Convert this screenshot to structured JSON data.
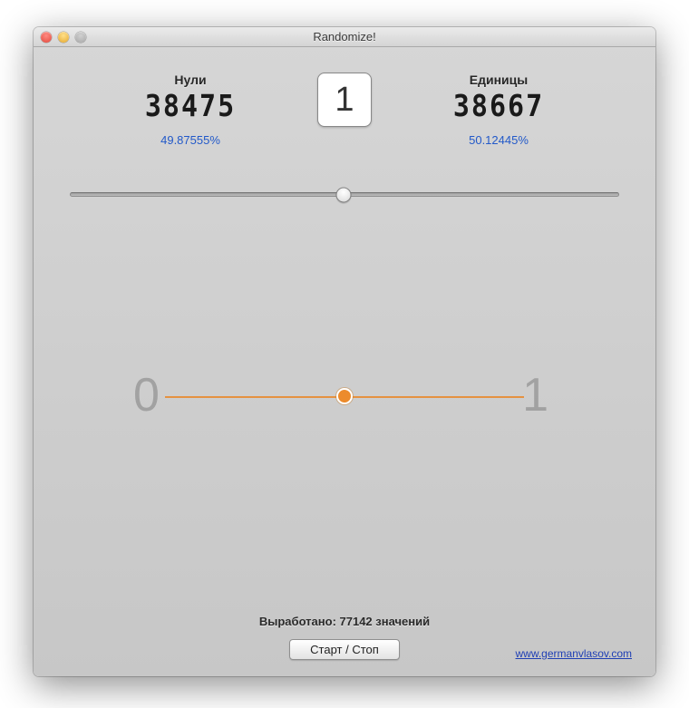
{
  "window": {
    "title": "Randomize!"
  },
  "stats": {
    "zeros": {
      "label": "Нули",
      "count": "38475",
      "percent": "49.87555%"
    },
    "ones": {
      "label": "Единицы",
      "count": "38667",
      "percent": "50.12445%"
    },
    "current": "1"
  },
  "slider": {
    "position_pct": 49.8
  },
  "viz": {
    "left_label": "0",
    "right_label": "1",
    "dot_pct": 50
  },
  "footer": {
    "generated": "Выработано: 77142 значений",
    "button": "Старт / Стоп",
    "link_text": "www.germanvlasov.com"
  },
  "colors": {
    "accent": "#ec8b2c",
    "link": "#1f3fb5",
    "percent": "#2259c9"
  }
}
